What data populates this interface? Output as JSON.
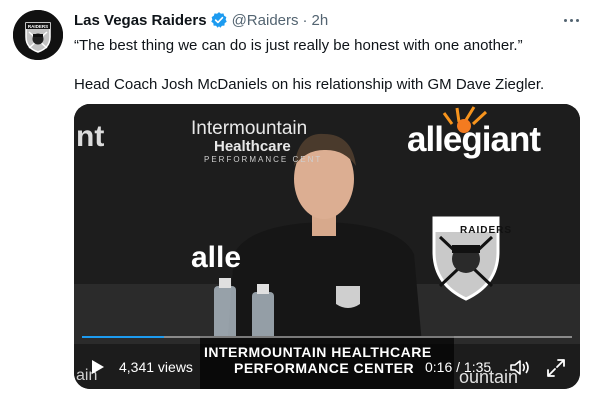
{
  "tweet": {
    "author_name": "Las Vegas Raiders",
    "handle": "@Raiders",
    "separator": "·",
    "time": "2h",
    "text_line1": "“The best thing we can do is just really be honest with one another.”",
    "text_line2": "Head Coach Josh McDaniels on his relationship with GM Dave Ziegler.",
    "avatar_text": "RAIDERS"
  },
  "video": {
    "backdrop": {
      "allegiant": "allegiant",
      "imh_line1": "Intermountain",
      "imh_line2": "Healthcare",
      "imh_line3": "PERFORMANCE CENT",
      "left_partial": "nt",
      "alle_partial": "alle",
      "shield_label": "RAIDERS",
      "bottom_left_partial": "ain",
      "bottom_right_partial": "ountain"
    },
    "podium_line1": "INTERMOUNTAIN HEALTHCARE",
    "podium_line2": "PERFORMANCE CENTER",
    "views": "4,341 views",
    "timecode": "0:16 / 1:35",
    "progress": 0.168
  },
  "colors": {
    "verified": "#1d9bf0",
    "progress": "#1d9bf0",
    "text_secondary": "#536471"
  },
  "icons": [
    "raiders-logo-icon",
    "verified-badge-icon",
    "more-icon",
    "play-icon",
    "volume-icon",
    "fullscreen-icon"
  ]
}
